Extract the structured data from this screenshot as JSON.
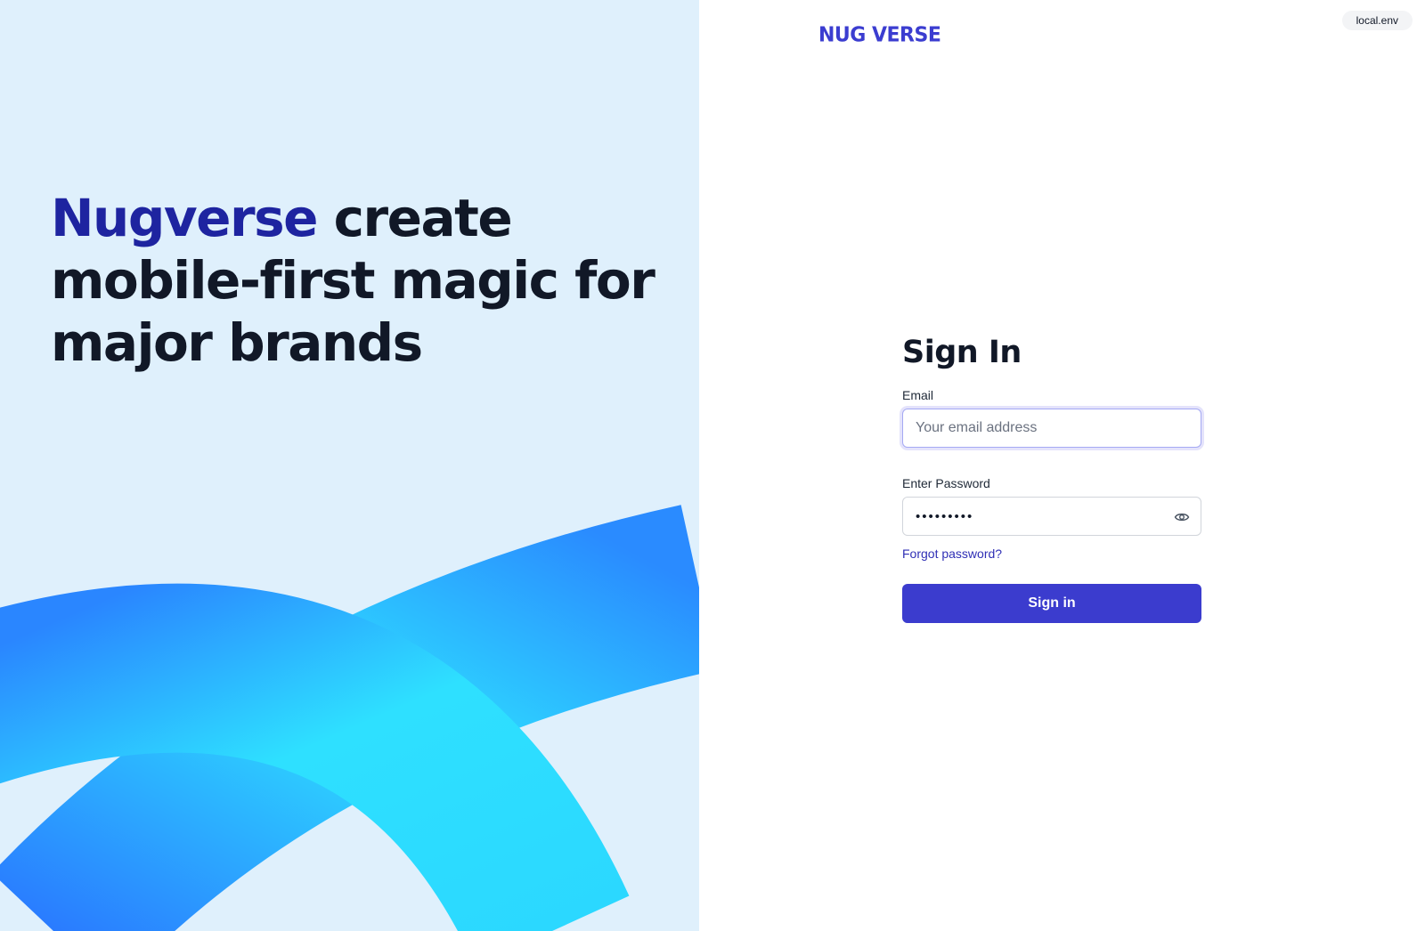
{
  "hero": {
    "accent": "Nugverse",
    "rest": " create mobile-first magic for major brands"
  },
  "brand": {
    "logo_text": "NUG VERSE"
  },
  "env_badge": "local.env",
  "form": {
    "title": "Sign In",
    "email": {
      "label": "Email",
      "placeholder": "Your email address",
      "value": ""
    },
    "password": {
      "label": "Enter Password",
      "value": "Password1",
      "toggle_icon": "eye-icon"
    },
    "forgot_link": "Forgot password?",
    "submit_label": "Sign in"
  },
  "colors": {
    "left_background": "#dff0fc",
    "hero_accent": "#1e24a0",
    "brand": "#3b3dd0",
    "primary_button": "#3b3cce",
    "link": "#2f2fb5",
    "ribbon_blue": "#2a7bff",
    "ribbon_cyan": "#2ee0ff"
  }
}
